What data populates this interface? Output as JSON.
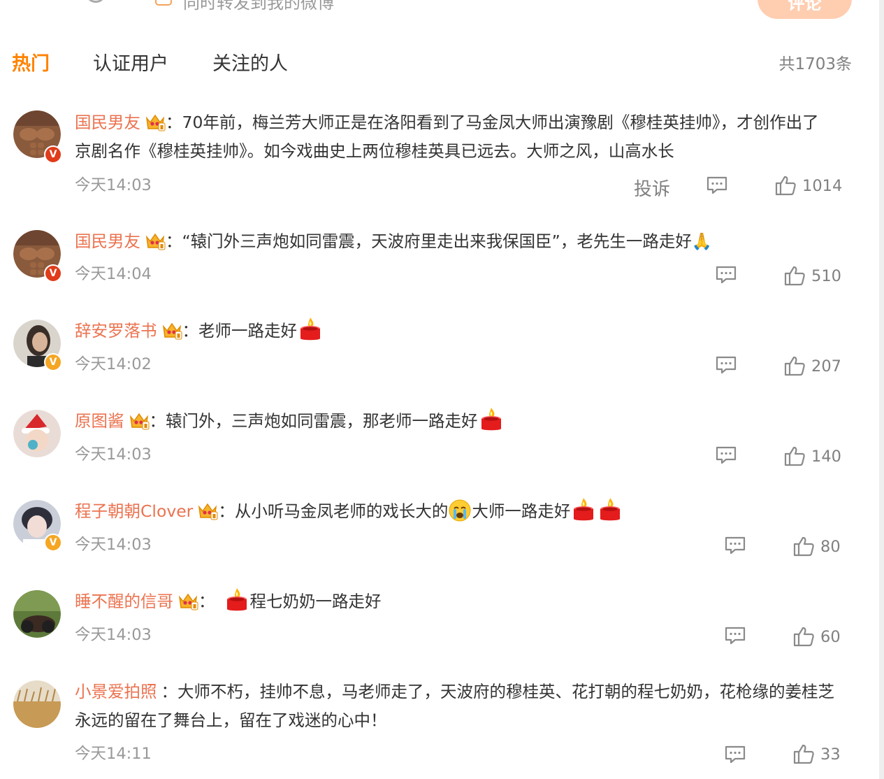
{
  "composer": {
    "forward_label": "同时转发到我的微博",
    "post_button": "评论"
  },
  "tabs": [
    "热门",
    "认证用户",
    "关注的人"
  ],
  "total_label": "共1703条",
  "actions": {
    "complain": "投诉"
  },
  "comments": [
    {
      "username": "国民男友",
      "colon": "：",
      "text_a": "70年前，梅兰芳大师正是在洛阳看到了马金凤大师出演豫剧《穆桂英挂帅》，才创作出了",
      "text_b": "京剧名作《穆桂英挂帅》。如今戏曲史上两位穆桂英具已远去。大师之风，山高水长",
      "time": "今天14:03",
      "likes": "1014"
    },
    {
      "username": "国民男友",
      "colon": "：",
      "text_a": "“辕门外三声炮如同雷震，天波府里走出来我保国臣”，老先生一路走好🙏",
      "time": "今天14:04",
      "likes": "510"
    },
    {
      "username": "辞安罗落书",
      "colon": "：",
      "text_a": "老师一路走好",
      "time": "今天14:02",
      "likes": "207"
    },
    {
      "username": "原图酱",
      "colon": "：",
      "text_a": "辕门外，三声炮如同雷震，那老师一路走好",
      "time": "今天14:03",
      "likes": "140"
    },
    {
      "username": "程子朝朝Clover",
      "colon": "：",
      "text_a": "从小听马金凤老师的戏长大的",
      "text_b": "大师一路走好",
      "time": "今天14:03",
      "likes": "80"
    },
    {
      "username": "睡不醒的信哥",
      "colon": "：",
      "text_a": "程七奶奶一路走好",
      "time": "今天14:03",
      "likes": "60"
    },
    {
      "username": "小景爱拍照",
      "colon": "：",
      "text_a": "大师不朽，挂帅不息，马老师走了，天波府的穆桂英、花打朝的程七奶奶，花枪缘的姜桂芝",
      "text_b": "永远的留在了舞台上，留在了戏迷的心中！",
      "time": "今天14:11",
      "likes": "33"
    }
  ],
  "colors": {
    "accent": "#ff8200",
    "username": "#eb7350",
    "meta": "#999999"
  }
}
